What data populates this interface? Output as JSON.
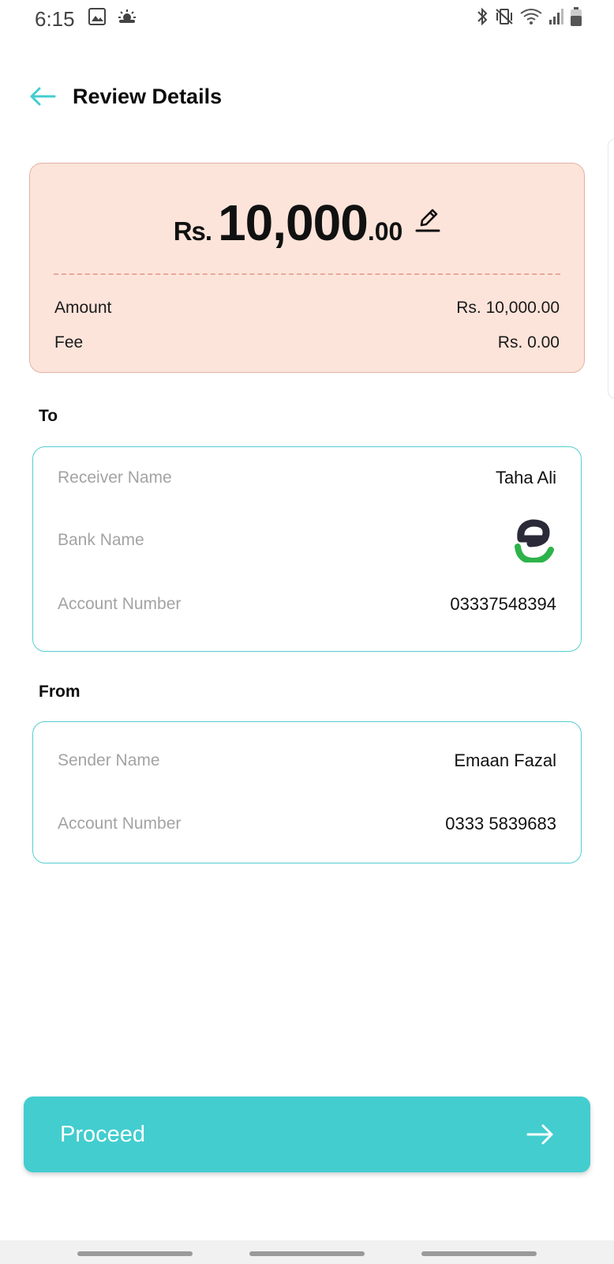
{
  "status_bar": {
    "time": "6:15",
    "left_icons": [
      "image-icon",
      "weather-icon"
    ],
    "right_icons": [
      "bluetooth-icon",
      "vibrate-icon",
      "wifi-icon",
      "signal-icon",
      "battery-icon"
    ]
  },
  "header": {
    "title": "Review Details",
    "back_icon": "arrow-left-icon"
  },
  "amount": {
    "currency": "Rs.",
    "whole": "10,000",
    "decimal": ".00",
    "edit_icon": "pencil-icon",
    "summary": [
      {
        "label": "Amount",
        "value": "Rs. 10,000.00"
      },
      {
        "label": "Fee",
        "value": "Rs. 0.00"
      }
    ]
  },
  "to": {
    "section_label": "To",
    "receiver_name_label": "Receiver Name",
    "receiver_name": "Taha Ali",
    "bank_name_label": "Bank Name",
    "bank_logo": "easypaisa-logo-icon",
    "account_number_label": "Account Number",
    "account_number": "03337548394"
  },
  "from": {
    "section_label": "From",
    "sender_name_label": "Sender Name",
    "sender_name": "Emaan Fazal",
    "account_number_label": "Account Number",
    "account_number": "0333 5839683"
  },
  "proceed": {
    "label": "Proceed",
    "icon": "arrow-right-icon"
  },
  "colors": {
    "accent": "#43cdcf",
    "amount_card_bg": "#fde4da",
    "card_border": "#54cdd0",
    "logo_green": "#2db34a",
    "logo_dark": "#2a2a38"
  }
}
